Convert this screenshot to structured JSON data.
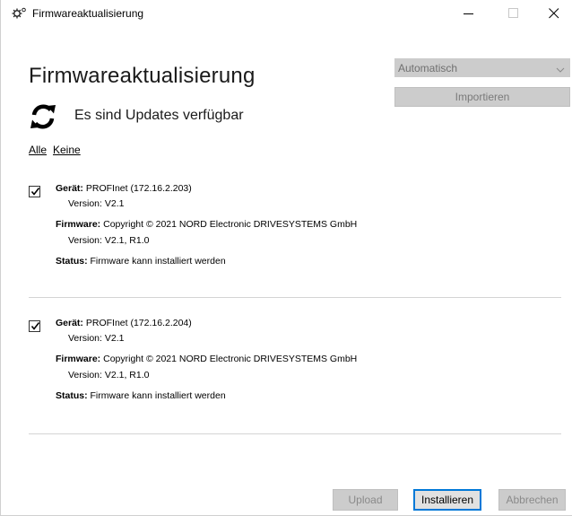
{
  "window": {
    "title": "Firmwareaktualisierung"
  },
  "header": {
    "heading": "Firmwareaktualisierung",
    "status": "Es sind Updates verfügbar",
    "select_all": "Alle",
    "select_none": "Keine"
  },
  "options": {
    "mode_value": "Automatisch",
    "import_label": "Importieren"
  },
  "labels": {
    "device": "Gerät:",
    "firmware": "Firmware:",
    "status": "Status:"
  },
  "devices": [
    {
      "checked": true,
      "name": "PROFInet (172.16.2.203)",
      "version": "Version: V2.1",
      "firmware": "Copyright © 2021 NORD Electronic DRIVESYSTEMS GmbH",
      "firmware_version": "Version: V2.1, R1.0",
      "status": "Firmware kann installiert werden"
    },
    {
      "checked": true,
      "name": "PROFInet (172.16.2.204)",
      "version": "Version: V2.1",
      "firmware": "Copyright © 2021 NORD Electronic DRIVESYSTEMS GmbH",
      "firmware_version": "Version: V2.1, R1.0",
      "status": "Firmware kann installiert werden"
    }
  ],
  "footer": {
    "upload_label": "Upload",
    "install_label": "Installieren",
    "cancel_label": "Abbrechen"
  },
  "icons": {
    "app": "gear-icon",
    "refresh": "refresh-icon",
    "minimize": "minimize-icon",
    "maximize": "maximize-icon",
    "close": "close-icon",
    "dropdown": "chevron-down-icon",
    "checkbox": "checkmark-icon"
  },
  "colors": {
    "accent": "#0078d7",
    "disabled_bg": "#cccccc",
    "disabled_text": "#8a8a8a"
  }
}
